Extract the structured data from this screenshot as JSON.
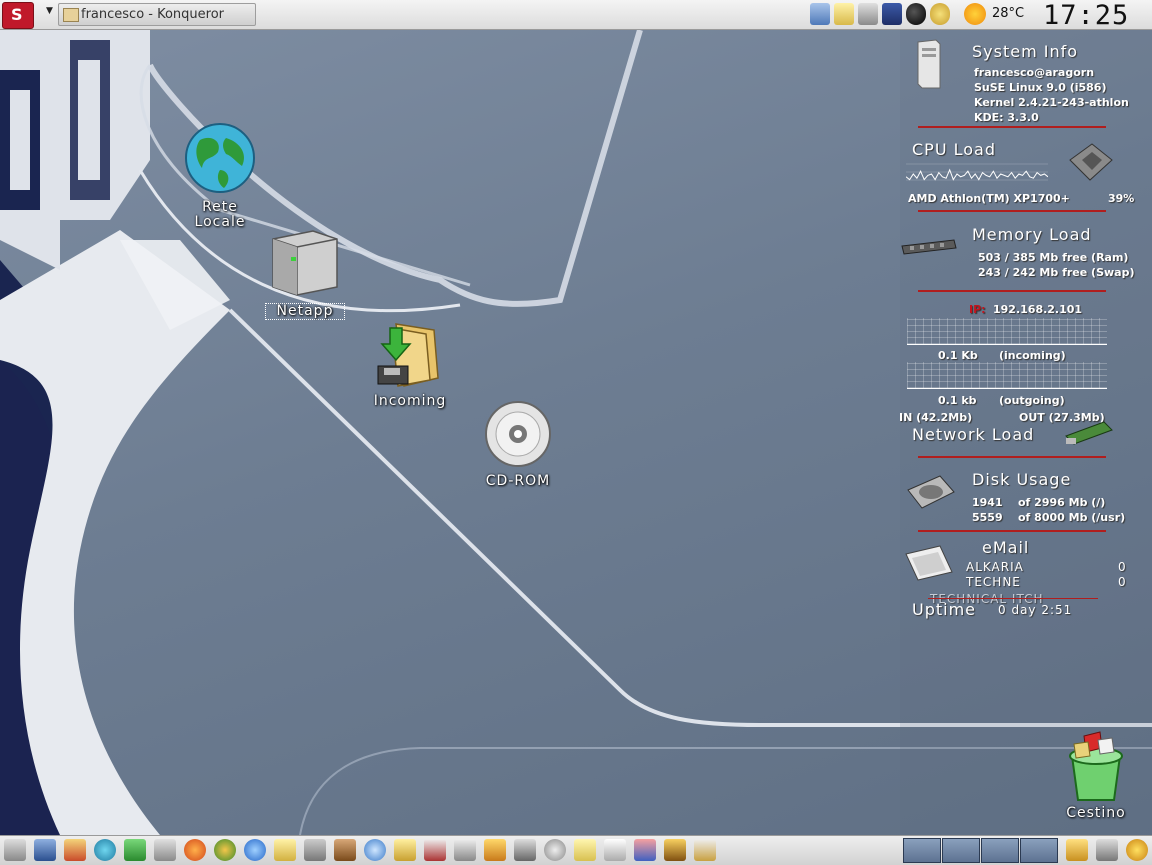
{
  "taskbar": {
    "window_title": "francesco - Konqueror",
    "temperature": "28°C",
    "clock": "17:25"
  },
  "desktop_icons": [
    {
      "label_line1": "Rete",
      "label_line2": "Locale",
      "icon": "globe-icon"
    },
    {
      "label_line1": "Netapp",
      "icon": "server-icon"
    },
    {
      "label_line1": "Incoming",
      "icon": "incoming-folder-icon"
    },
    {
      "label_line1": "CD-ROM",
      "icon": "cdrom-icon"
    },
    {
      "label_line1": "Cestino",
      "icon": "trash-icon"
    }
  ],
  "system_info": {
    "title": "System Info",
    "user": "francesco@aragorn",
    "os": "SuSE Linux 9.0 (i586)",
    "kernel": "Kernel 2.4.21-243-athlon",
    "kde": "KDE: 3.3.0"
  },
  "cpu": {
    "title": "CPU Load",
    "model": "AMD Athlon(TM) XP1700+",
    "load": "39%",
    "history": [
      0.4,
      0.3,
      0.5,
      0.35,
      0.6,
      0.3,
      0.45,
      0.5,
      0.3,
      0.55,
      0.4,
      0.35,
      0.65,
      0.3,
      0.5,
      0.4,
      0.45,
      0.6,
      0.35,
      0.5,
      0.3,
      0.55,
      0.45,
      0.4,
      0.6,
      0.35,
      0.5,
      0.45,
      0.4,
      0.55,
      0.35,
      0.5,
      0.45,
      0.6,
      0.4,
      0.35,
      0.55,
      0.45,
      0.5,
      0.4
    ]
  },
  "memory": {
    "title": "Memory Load",
    "ram": "503 /  385 Mb free (Ram)",
    "swap": "243 /  242 Mb free (Swap)"
  },
  "network": {
    "ip_label": "IP:",
    "ip": "192.168.2.101",
    "incoming_value": "0.1 Kb",
    "incoming_label": "(incoming)",
    "outgoing_value": "0.1 kb",
    "outgoing_label": "(outgoing)",
    "in_total": "IN  (42.2Mb)",
    "out_total": "OUT   (27.3Mb)",
    "title": "Network Load"
  },
  "disk": {
    "title": "Disk Usage",
    "root_used": "1941",
    "root_total": "of 2996 Mb (/)",
    "usr_used": "5559",
    "usr_total": "of 8000 Mb (/usr)"
  },
  "email": {
    "title": "eMail",
    "accounts": [
      {
        "name": "ALKARIA",
        "count": "0"
      },
      {
        "name": "TECHNE",
        "count": "0"
      },
      {
        "name": "TECHNICAL ITCH",
        "count": ""
      }
    ]
  },
  "uptime": {
    "label": "Uptime",
    "value": "0 day 2:51"
  },
  "colors": {
    "separator": "#b01e1e",
    "ip_label": "#c0141e"
  }
}
